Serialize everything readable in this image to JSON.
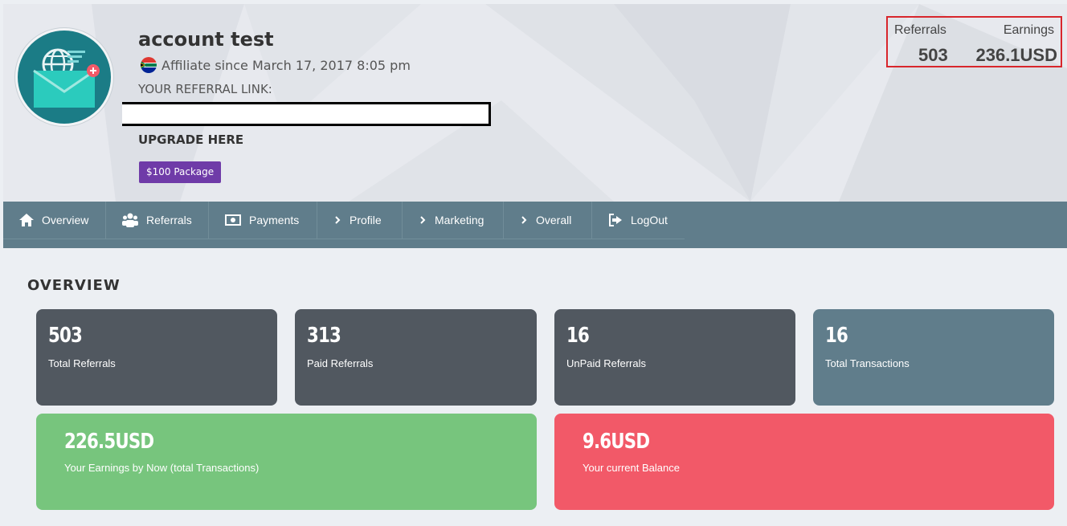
{
  "profile": {
    "name": "account test",
    "affiliate_since": "Affiliate since March 17, 2017 8:05 pm",
    "referral_link_label": "YOUR REFERRAL LINK:",
    "upgrade_label": "UPGRADE HERE",
    "package_button": "$100 Package"
  },
  "summary": {
    "referrals_label": "Referrals",
    "referrals_value": "503",
    "earnings_label": "Earnings",
    "earnings_value": "236.1USD"
  },
  "nav": [
    {
      "label": "Overview",
      "icon": "home-icon"
    },
    {
      "label": "Referrals",
      "icon": "users-icon"
    },
    {
      "label": "Payments",
      "icon": "money-icon"
    },
    {
      "label": "Profile",
      "icon": "chevron-right-icon"
    },
    {
      "label": "Marketing",
      "icon": "chevron-right-icon"
    },
    {
      "label": "Overall",
      "icon": "chevron-right-icon"
    },
    {
      "label": "LogOut",
      "icon": "logout-icon"
    }
  ],
  "overview": {
    "title": "OVERVIEW",
    "cards": [
      {
        "value": "503",
        "label": "Total Referrals"
      },
      {
        "value": "313",
        "label": "Paid Referrals"
      },
      {
        "value": "16",
        "label": "UnPaid Referrals"
      },
      {
        "value": "16",
        "label": "Total Transactions"
      },
      {
        "value": "226.5USD",
        "label": "Your Earnings by Now (total Transactions)"
      },
      {
        "value": "9.6USD",
        "label": "Your current Balance"
      }
    ]
  },
  "colors": {
    "nav": "#607d8b",
    "card_dark": "#515860",
    "card_slate": "#607d8b",
    "card_green": "#77c57d",
    "card_red": "#f25968",
    "package_purple": "#6f3ba8",
    "highlight_border": "#d8262c"
  }
}
